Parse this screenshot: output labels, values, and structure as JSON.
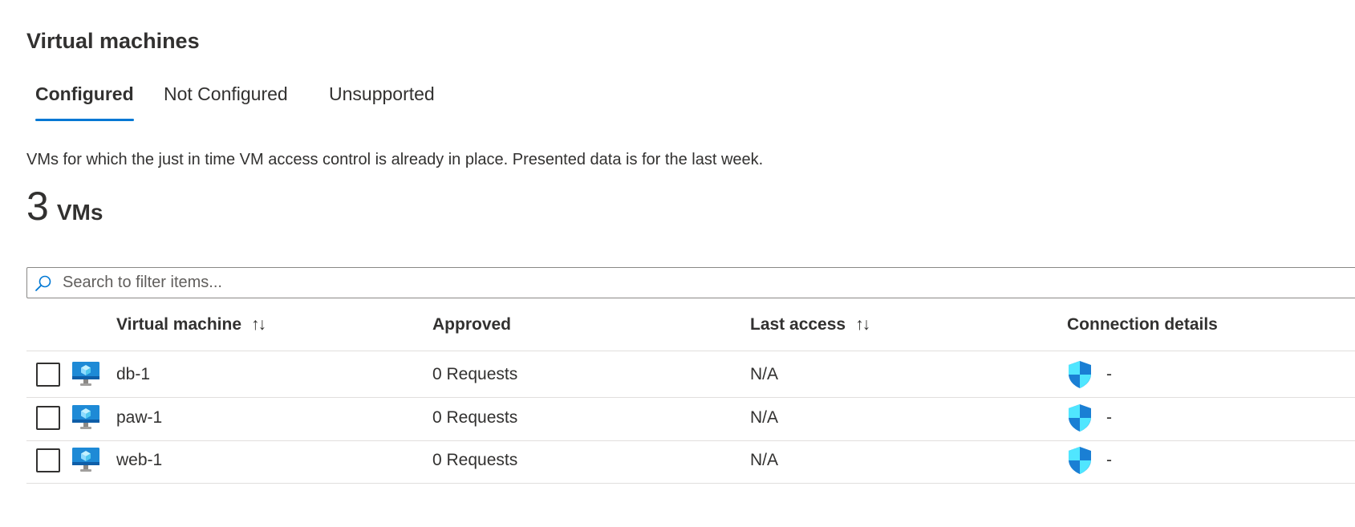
{
  "page": {
    "title": "Virtual machines",
    "description": "VMs for which the just in time VM access control is already in place. Presented data is for the last week."
  },
  "tabs": [
    {
      "label": "Configured",
      "active": true
    },
    {
      "label": "Not Configured",
      "active": false
    },
    {
      "label": "Unsupported",
      "active": false
    }
  ],
  "summary": {
    "count": "3",
    "unit": "VMs"
  },
  "search": {
    "placeholder": "Search to filter items...",
    "value": ""
  },
  "columns": [
    {
      "label": "Virtual machine",
      "sortable": true
    },
    {
      "label": "Approved",
      "sortable": false
    },
    {
      "label": "Last access",
      "sortable": true
    },
    {
      "label": "Connection details",
      "sortable": false
    }
  ],
  "sort_glyph": "↑↓",
  "rows": [
    {
      "name": "db-1",
      "approved": "0 Requests",
      "last_access": "N/A",
      "connection": "-"
    },
    {
      "name": "paw-1",
      "approved": "0 Requests",
      "last_access": "N/A",
      "connection": "-"
    },
    {
      "name": "web-1",
      "approved": "0 Requests",
      "last_access": "N/A",
      "connection": "-"
    }
  ],
  "icons": {
    "search": "search-icon",
    "vm": "virtual-machine-icon",
    "shield": "shield-icon"
  },
  "colors": {
    "accent": "#0078d4",
    "text": "#323130",
    "border": "#e1dfdd",
    "vm_monitor": "#1e8ad6",
    "shield_light": "#50e6ff",
    "shield_dark": "#1a7fd4"
  }
}
